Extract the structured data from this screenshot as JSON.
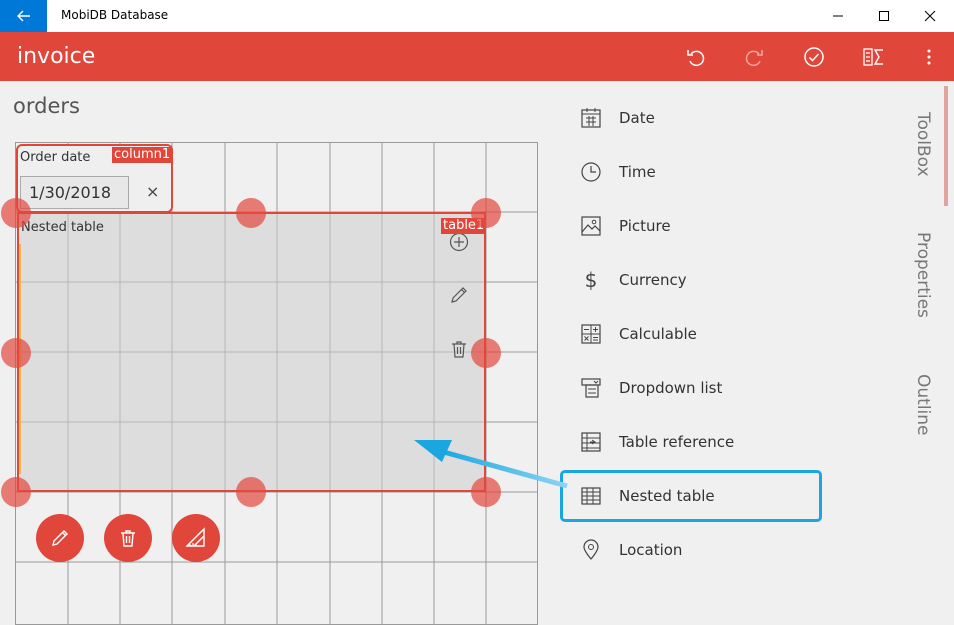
{
  "app": {
    "title": "MobiDB Database"
  },
  "appbar": {
    "title": "invoice"
  },
  "page": {
    "title": "orders"
  },
  "canvas": {
    "column_field": {
      "label": "Order date",
      "tag": "column1",
      "value": "1/30/2018",
      "clear_glyph": "×"
    },
    "table_field": {
      "label": "Nested table",
      "tag": "table1"
    }
  },
  "toolbox": {
    "items": [
      {
        "label": "Date",
        "icon": "calendar-icon"
      },
      {
        "label": "Time",
        "icon": "clock-icon"
      },
      {
        "label": "Picture",
        "icon": "picture-icon"
      },
      {
        "label": "Currency",
        "icon": "dollar-icon"
      },
      {
        "label": "Calculable",
        "icon": "calculator-icon"
      },
      {
        "label": "Dropdown list",
        "icon": "dropdown-list-icon"
      },
      {
        "label": "Table reference",
        "icon": "table-reference-icon"
      },
      {
        "label": "Nested table",
        "icon": "nested-table-icon"
      },
      {
        "label": "Location",
        "icon": "location-icon"
      }
    ],
    "currency_glyph": "$"
  },
  "side_tabs": {
    "toolbox": "ToolBox",
    "properties": "Properties",
    "outline": "Outline"
  },
  "colors": {
    "accent": "#e0463a",
    "titlebar_accent": "#0078d7",
    "callout": "#1aa7e0"
  }
}
